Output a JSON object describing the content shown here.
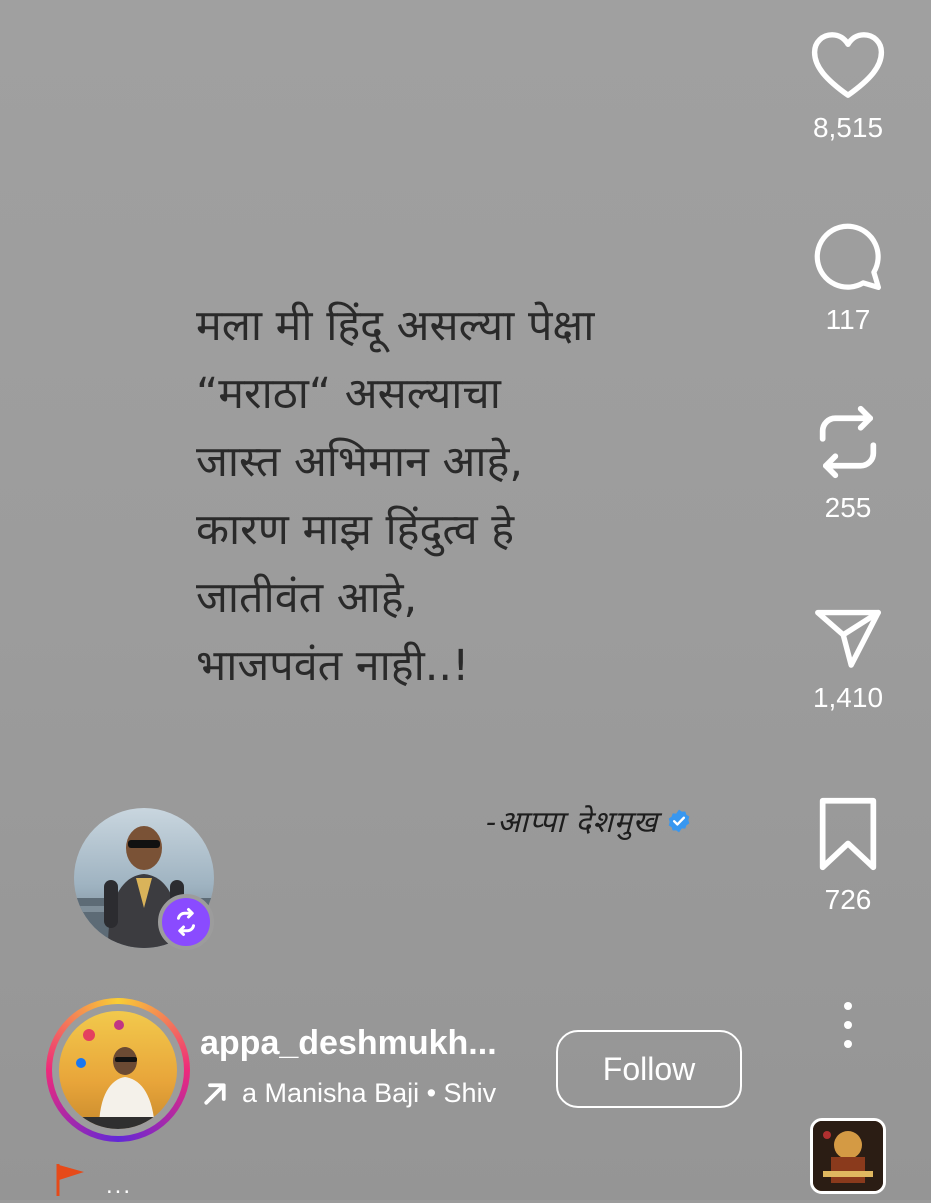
{
  "post": {
    "quote_lines": [
      "मला मी हिंदू असल्या पेक्षा",
      "“मराठा“ असल्याचा",
      "जास्त अभिमान आहे,",
      "कारण माझ हिंदुत्व हे",
      "जातीवंत आहे,",
      "भाजपवंत नाही..!"
    ],
    "signature": "-आप्पा देशमुख"
  },
  "actions": {
    "likes": "8,515",
    "comments": "117",
    "reposts": "255",
    "shares": "1,410",
    "saves": "726"
  },
  "author": {
    "username": "appa_deshmukh...",
    "audio": "a Manisha Baji • Shiv",
    "follow_label": "Follow"
  },
  "footer": {
    "ellipsis": "..."
  },
  "colors": {
    "background": "#9c9c9c",
    "repost_badge": "#8a4bff",
    "verified": "#3897f0",
    "flag": "#e64a19"
  },
  "icons": {
    "like": "heart-icon",
    "comment": "comment-bubble-icon",
    "repost": "repost-icon",
    "share": "send-icon",
    "save": "bookmark-icon",
    "more": "more-dots-icon",
    "audio_arrow": "arrow-up-right-icon",
    "verified": "verified-badge-icon",
    "flag": "flag-icon"
  }
}
